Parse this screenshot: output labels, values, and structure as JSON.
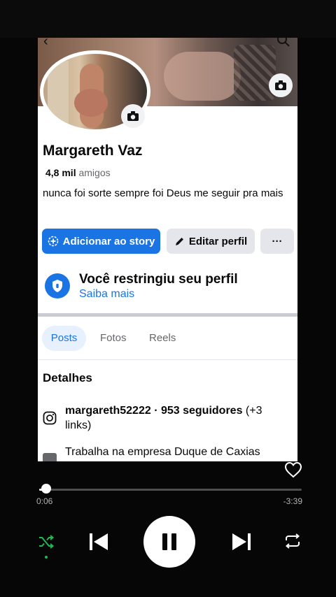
{
  "profile": {
    "name": "Margareth Vaz",
    "friends_count": "4,8 mil",
    "friends_label": "amigos",
    "bio": "nunca foi sorte sempre foi Deus me seguir pra mais"
  },
  "actions": {
    "add_story": "Adicionar ao story",
    "edit_profile": "Editar perfil",
    "more": "···"
  },
  "restriction": {
    "title": "Você restringiu seu perfil",
    "link": "Saiba mais"
  },
  "tabs": [
    {
      "label": "Posts",
      "active": true
    },
    {
      "label": "Fotos",
      "active": false
    },
    {
      "label": "Reels",
      "active": false
    }
  ],
  "details": {
    "title": "Detalhes",
    "instagram_handle": "margareth52222 · 953 seguidores",
    "instagram_extra": " (+3 links)",
    "work": "Trabalha na empresa Duque de Caxias"
  },
  "player": {
    "elapsed": "0:06",
    "remaining": "-3:39",
    "progress": 0.027,
    "shuffle_active": true,
    "is_playing": true
  },
  "colors": {
    "facebook_blue": "#1b74e4",
    "player_bg": "#060606",
    "shuffle_green": "#1db954"
  },
  "icons": {
    "back": "back-arrow-icon",
    "search": "search-icon",
    "camera": "camera-icon",
    "story": "add-story-icon",
    "edit": "pencil-icon",
    "shield": "shield-icon",
    "instagram": "instagram-icon",
    "work": "briefcase-icon",
    "heart": "heart-icon",
    "shuffle": "shuffle-icon",
    "previous": "skip-previous-icon",
    "pause": "pause-icon",
    "next": "skip-next-icon",
    "repeat": "repeat-icon"
  }
}
